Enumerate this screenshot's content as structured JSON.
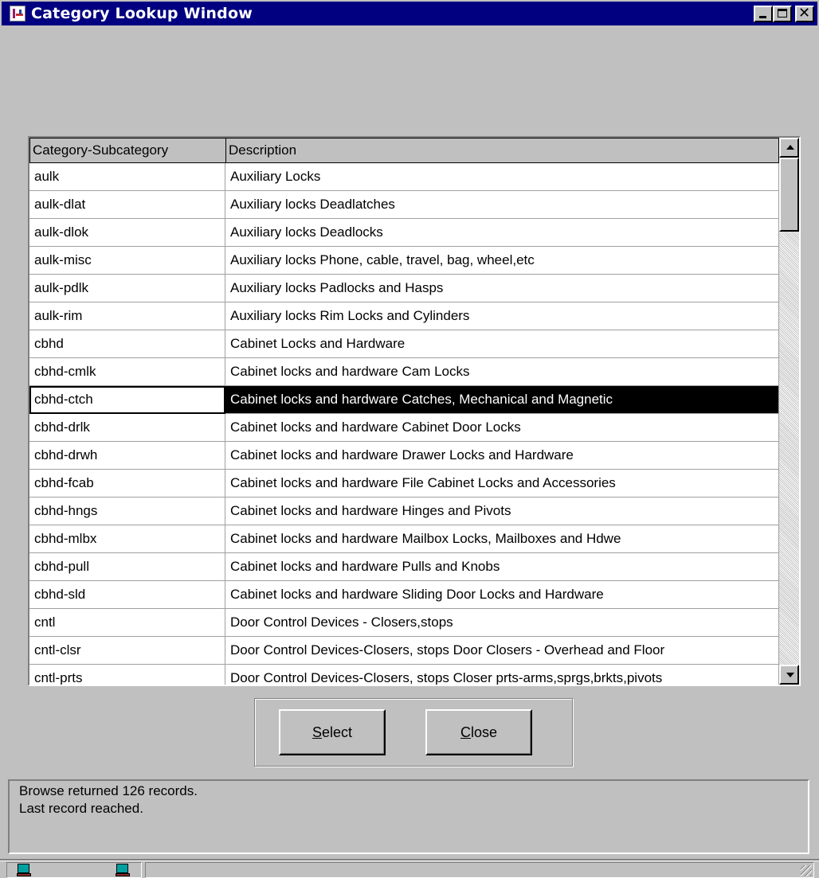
{
  "window": {
    "title": "Category Lookup Window",
    "titlebar_color": "#000080",
    "icons": [
      "app-icon",
      "minimize-icon",
      "maximize-icon",
      "close-icon"
    ]
  },
  "grid": {
    "columns": [
      "Category-Subcategory",
      "Description"
    ],
    "rows": [
      {
        "code": "aulk",
        "description": "Auxiliary Locks"
      },
      {
        "code": "aulk-dlat",
        "description": "Auxiliary locks Deadlatches"
      },
      {
        "code": "aulk-dlok",
        "description": "Auxiliary locks Deadlocks"
      },
      {
        "code": "aulk-misc",
        "description": "Auxiliary locks Phone, cable, travel, bag, wheel,etc"
      },
      {
        "code": "aulk-pdlk",
        "description": "Auxiliary locks Padlocks and Hasps"
      },
      {
        "code": "aulk-rim",
        "description": "Auxiliary locks Rim Locks and Cylinders"
      },
      {
        "code": "cbhd",
        "description": "Cabinet Locks and Hardware"
      },
      {
        "code": "cbhd-cmlk",
        "description": "Cabinet locks and hardware Cam Locks"
      },
      {
        "code": "cbhd-ctch",
        "description": "Cabinet locks and hardware Catches, Mechanical and Magnetic"
      },
      {
        "code": "cbhd-drlk",
        "description": "Cabinet locks and hardware Cabinet Door Locks"
      },
      {
        "code": "cbhd-drwh",
        "description": "Cabinet locks and hardware Drawer Locks and Hardware"
      },
      {
        "code": "cbhd-fcab",
        "description": "Cabinet locks and hardware File Cabinet Locks and Accessories"
      },
      {
        "code": "cbhd-hngs",
        "description": "Cabinet locks and hardware Hinges and Pivots"
      },
      {
        "code": "cbhd-mlbx",
        "description": "Cabinet locks and hardware Mailbox Locks, Mailboxes and Hdwe"
      },
      {
        "code": "cbhd-pull",
        "description": "Cabinet locks and hardware Pulls and Knobs"
      },
      {
        "code": "cbhd-sld",
        "description": "Cabinet locks and hardware Sliding Door Locks and Hardware"
      },
      {
        "code": "cntl",
        "description": "Door Control Devices - Closers,stops"
      },
      {
        "code": "cntl-clsr",
        "description": "Door Control Devices-Closers, stops Door Closers - Overhead and Floor"
      },
      {
        "code": "cntl-prts",
        "description": "Door Control Devices-Closers, stops Closer prts-arms,sprgs,brkts,pivots"
      }
    ],
    "selected_index": 8,
    "selection_color": "#000000",
    "scroll_icons": [
      "scroll-up-icon",
      "scroll-down-icon"
    ]
  },
  "buttons": {
    "select_label": "Select",
    "close_label": "Close"
  },
  "status": {
    "line1": "Browse returned 126 records.",
    "line2": "Last record reached."
  },
  "statusbar": {
    "icons": [
      "computer-icon",
      "computer-icon"
    ]
  }
}
